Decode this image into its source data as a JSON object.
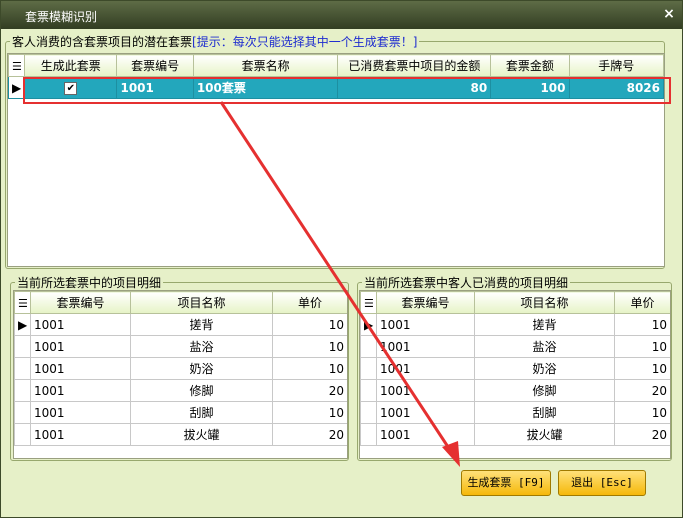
{
  "window": {
    "title": "套票模糊识别",
    "close_label": "×"
  },
  "top_group": {
    "title": "客人消费的含套票项目的潜在套票",
    "hint": "[提示：每次只能选择其中一个生成套票！]",
    "columns": [
      "生成此套票",
      "套票编号",
      "套票名称",
      "已消费套票中项目的金额",
      "套票金额",
      "手牌号"
    ],
    "rows": [
      {
        "checked": true,
        "code": "1001",
        "name": "100套票",
        "consumed": "80",
        "amount": "100",
        "tag": "8026"
      }
    ]
  },
  "left_group": {
    "title": "当前所选套票中的项目明细",
    "columns": [
      "套票编号",
      "项目名称",
      "单价"
    ],
    "rows": [
      {
        "code": "1001",
        "name": "搓背",
        "price": "10"
      },
      {
        "code": "1001",
        "name": "盐浴",
        "price": "10"
      },
      {
        "code": "1001",
        "name": "奶浴",
        "price": "10"
      },
      {
        "code": "1001",
        "name": "修脚",
        "price": "20"
      },
      {
        "code": "1001",
        "name": "刮脚",
        "price": "10"
      },
      {
        "code": "1001",
        "name": "拔火罐",
        "price": "20"
      }
    ]
  },
  "right_group": {
    "title": "当前所选套票中客人已消费的项目明细",
    "columns": [
      "套票编号",
      "项目名称",
      "单价"
    ],
    "rows": [
      {
        "code": "1001",
        "name": "搓背",
        "price": "10"
      },
      {
        "code": "1001",
        "name": "盐浴",
        "price": "10"
      },
      {
        "code": "1001",
        "name": "奶浴",
        "price": "10"
      },
      {
        "code": "1001",
        "name": "修脚",
        "price": "20"
      },
      {
        "code": "1001",
        "name": "刮脚",
        "price": "10"
      },
      {
        "code": "1001",
        "name": "拔火罐",
        "price": "20"
      }
    ]
  },
  "buttons": {
    "generate": "生成套票 [F9]",
    "exit": "退出 [Esc]"
  },
  "colors": {
    "selected_row": "#23a7bc",
    "annotation": "#e53030",
    "button": "#f5b80a"
  },
  "icons": {
    "grid": "grid-icon",
    "row_pointer": "row-pointer-icon",
    "close": "close-icon"
  }
}
